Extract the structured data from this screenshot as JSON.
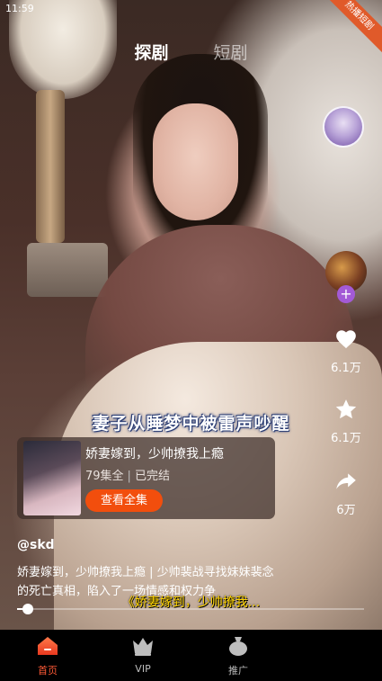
{
  "status_bar": {
    "time": "11:59"
  },
  "corner_badge": {
    "label": "热播短剧"
  },
  "top_tabs": [
    {
      "label": "探剧",
      "active": true
    },
    {
      "label": "短剧",
      "active": false
    }
  ],
  "right_rail": {
    "like": {
      "count": "6.1万",
      "icon": "heart-icon"
    },
    "favorite": {
      "count": "6.1万",
      "icon": "star-icon"
    },
    "share": {
      "count": "6万",
      "icon": "share-icon"
    },
    "follow_badge": "+"
  },
  "subtitle": "妻子从睡梦中被雷声吵醒",
  "drama_card": {
    "title": "娇妻嫁到，少帅撩我上瘾",
    "episodes": "79集全",
    "status": "已完结",
    "separator": "|",
    "button_label": "查看全集"
  },
  "author": "@skd",
  "description": "娇妻嫁到，少帅撩我上瘾 | 少帅裴战寻找妹妹裴念的死亡真相，陷入了一场情感和权力争",
  "overlay_caption": "《娇妻嫁到，少帅撩我...",
  "progress": {
    "fraction": 0.03
  },
  "bottom_nav": [
    {
      "label": "首页",
      "icon": "home-icon",
      "active": true
    },
    {
      "label": "VIP",
      "icon": "crown-icon",
      "active": false
    },
    {
      "label": "推广",
      "icon": "money-bag-icon",
      "active": false
    }
  ],
  "colors": {
    "accent": "#f24e0d",
    "nav_active": "#ff5a36",
    "follow_badge": "#a35ad6"
  }
}
